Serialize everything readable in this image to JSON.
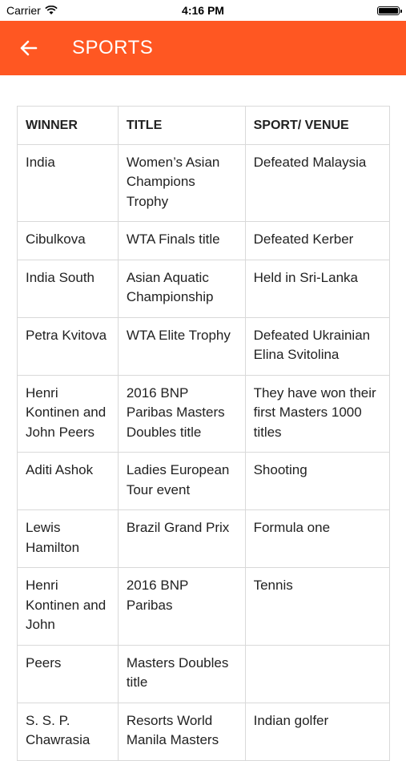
{
  "status": {
    "carrier": "Carrier",
    "time": "4:16 PM"
  },
  "header": {
    "title": "SPORTS"
  },
  "table": {
    "headers": [
      "WINNER",
      "TITLE",
      "SPORT/ VENUE"
    ],
    "rows": [
      [
        "India",
        "Women’s Asian Champions Trophy",
        "Defeated Malaysia"
      ],
      [
        "Cibulkova",
        "WTA Finals title",
        "Defeated Kerber"
      ],
      [
        "India South",
        "Asian Aquatic Championship",
        "Held in Sri-Lanka"
      ],
      [
        "Petra Kvitova",
        "WTA Elite Trophy",
        "Defeated Ukrainian Elina Svitolina"
      ],
      [
        "Henri Kontinen and John Peers",
        "2016 BNP Paribas Masters Doubles title",
        "They have won their first Masters 1000 titles"
      ],
      [
        "Aditi Ashok",
        "Ladies European Tour event",
        "Shooting"
      ],
      [
        "Lewis Hamilton",
        "Brazil Grand Prix",
        "Formula one"
      ],
      [
        "Henri Kontinen and John",
        "2016 BNP Paribas",
        "Tennis"
      ],
      [
        "Peers",
        "Masters Doubles title",
        ""
      ],
      [
        "S. S. P. Chawrasia",
        "Resorts World Manila Masters",
        "Indian golfer"
      ]
    ]
  }
}
